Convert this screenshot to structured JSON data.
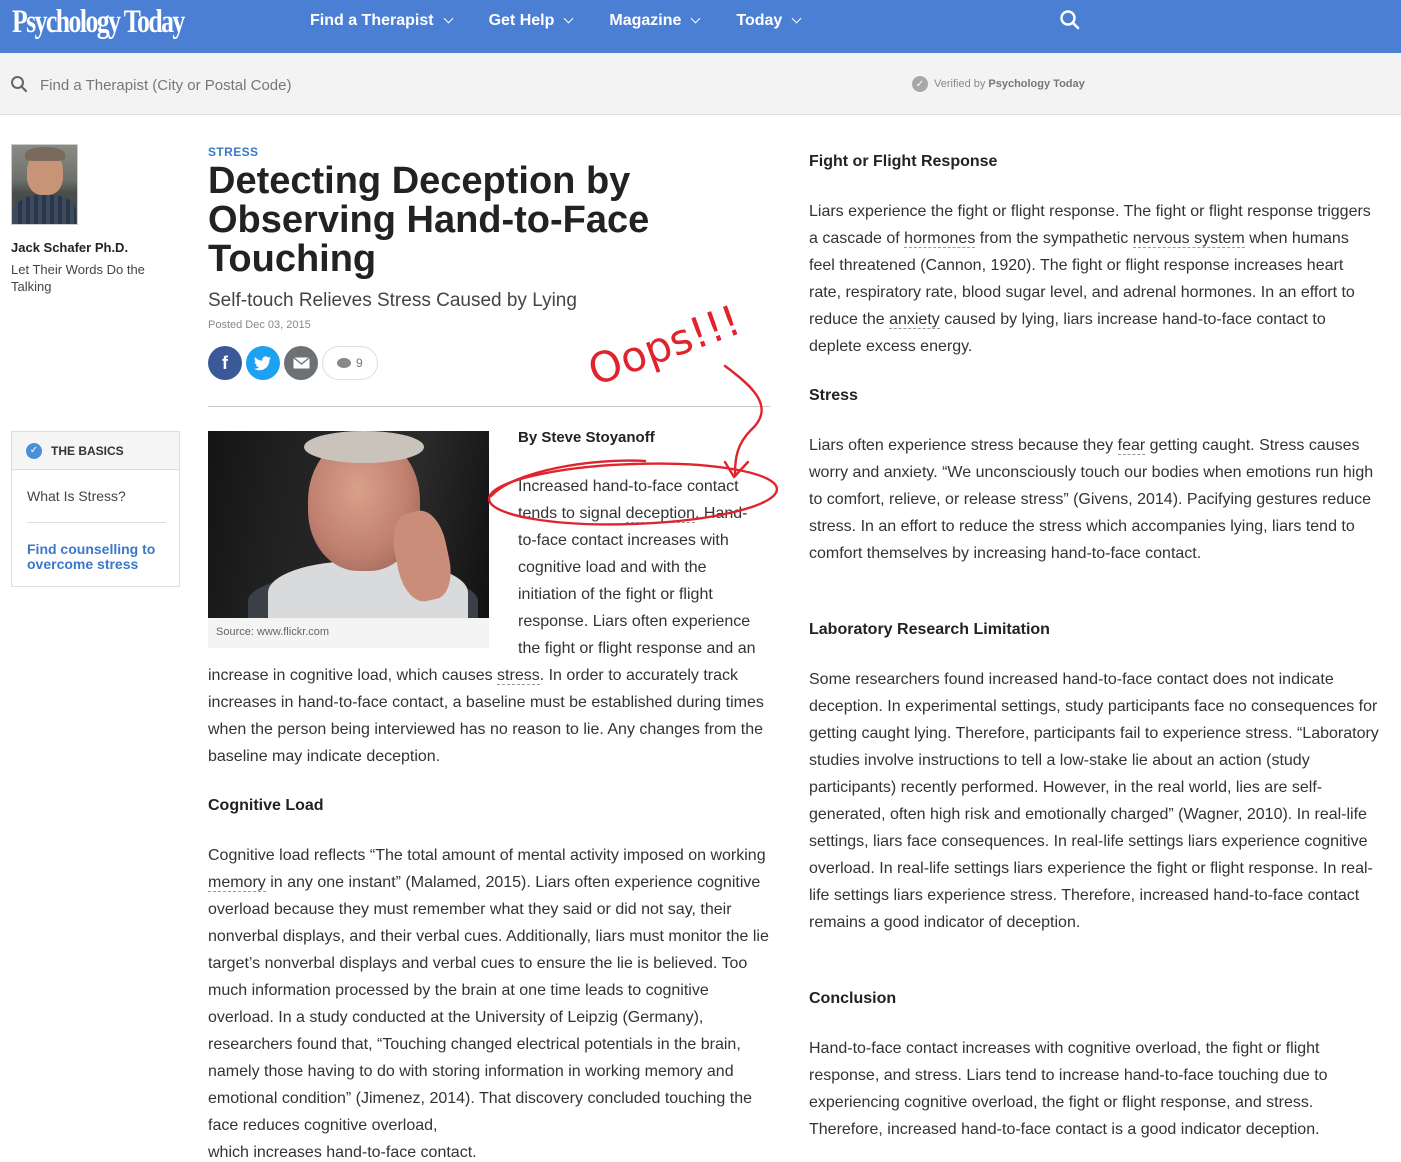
{
  "header": {
    "logo": "Psychology Today",
    "nav": [
      "Find a Therapist",
      "Get Help",
      "Magazine",
      "Today"
    ],
    "search_icon": "search-icon"
  },
  "subbar": {
    "placeholder": "Find a Therapist (City or Postal Code)",
    "verified_prefix": "Verified by",
    "verified_brand": "Psychology Today"
  },
  "author": {
    "name": "Jack Schafer Ph.D.",
    "blog": "Let Their Words Do the Talking"
  },
  "basics": {
    "heading": "THE BASICS",
    "item": "What Is Stress?",
    "link": "Find counselling to overcome stress"
  },
  "article": {
    "category": "STRESS",
    "title": "Detecting Deception by Observing Hand-to-Face Touching",
    "subtitle": "Self-touch Relieves Stress Caused by Lying",
    "posted": "Posted Dec 03, 2015",
    "comment_count": "9",
    "image_caption": "Source: www.flickr.com",
    "byline": "By Steve Stoyanoff",
    "intro_lines": [
      "Increased hand-to-face contact",
      "to-face contact  increases with",
      "cognitive load and with the",
      "initiation of the fight or flight",
      "response. Liars often experience",
      "the fight or flight response and an"
    ],
    "intro_line2_a": "tends to signal ",
    "intro_line2_link": "deception",
    "intro_line2_b": ". Hand-",
    "intro_cont_a": "increase in cognitive load, which causes ",
    "intro_cont_link": "stress",
    "intro_cont_b": ". In order to accurately track increases in hand-to-face contact, a baseline must be established during times when the person being interviewed has no reason to lie. Any changes from the baseline may indicate deception.",
    "h_cognitive": "Cognitive Load",
    "cog_a": "Cognitive load reflects “The total amount of mental activity imposed on working ",
    "cog_link": "memory",
    "cog_b": " in any one instant” (Malamed, 2015). Liars often experience cognitive overload because they must remember what they said or did not say, their nonverbal displays, and their verbal cues. Additionally, liars must monitor the lie target’s nonverbal displays and verbal cues to ensure the lie is believed. Too much information processed by the brain at one time leads to cognitive overload.  In a study conducted at the University of Leipzig (Germany), researchers found that, “Touching changed electrical potentials in the brain, namely those having to do with storing information in working memory and emotional condition” (Jimenez, 2014). That discovery concluded touching the face reduces cognitive overload,",
    "cog_last": "which increases hand-to-face contact.",
    "h_fight": "Fight or Flight Response",
    "fight_a": "Liars experience the fight or flight response. The fight or flight response triggers a cascade of ",
    "fight_link1": "hormones",
    "fight_b": " from the sympathetic ",
    "fight_link2": "nervous system",
    "fight_c": " when humans feel threatened (Cannon, 1920). The fight or flight response increases heart rate, respiratory rate, blood sugar level, and adrenal hormones. In an effort to reduce the ",
    "fight_link3": "anxiety",
    "fight_d": " caused by lying, liars increase hand-to-face contact to deplete excess energy.",
    "h_stress": "Stress",
    "stress_a": "Liars often experience stress because they ",
    "stress_link": "fear",
    "stress_b": " getting caught. Stress causes worry and anxiety. “We unconsciously touch our bodies when emotions run high to comfort, relieve, or release stress” (Givens, 2014).  Pacifying gestures reduce stress. In an effort to reduce the stress which accompanies lying, liars tend to comfort themselves by increasing hand-to-face contact.",
    "h_lab": "Laboratory Research  Limitation",
    "lab": "Some researchers found increased hand-to-face contact does not indicate deception. In experimental settings, study participants face no consequences for getting caught lying. Therefore, participants fail to experience stress. “Laboratory studies involve instructions to tell a low-stake lie about an action (study participants) recently performed. However, in the real world, lies are self-generated, often high risk and emotionally charged” (Wagner, 2010). In real-life settings, liars face consequences. In real-life settings liars experience cognitive overload. In real-life settings liars experience the fight or flight response. In real-life settings liars experience stress. Therefore, increased hand-to-face contact remains a good indicator of deception.",
    "h_conclusion": "Conclusion",
    "conclusion": "Hand-to-face contact increases with cognitive overload, the  fight or flight response, and stress. Liars tend to increase hand-to-face touching due to experiencing cognitive overload, the fight or flight response, and stress. Therefore, increased hand-to-face contact is a good indicator deception."
  },
  "annotation": {
    "text": "Oops!!!",
    "color": "#e0232d"
  },
  "colors": {
    "brand_blue": "#4a7fd4",
    "link_blue": "#3a78c9"
  }
}
